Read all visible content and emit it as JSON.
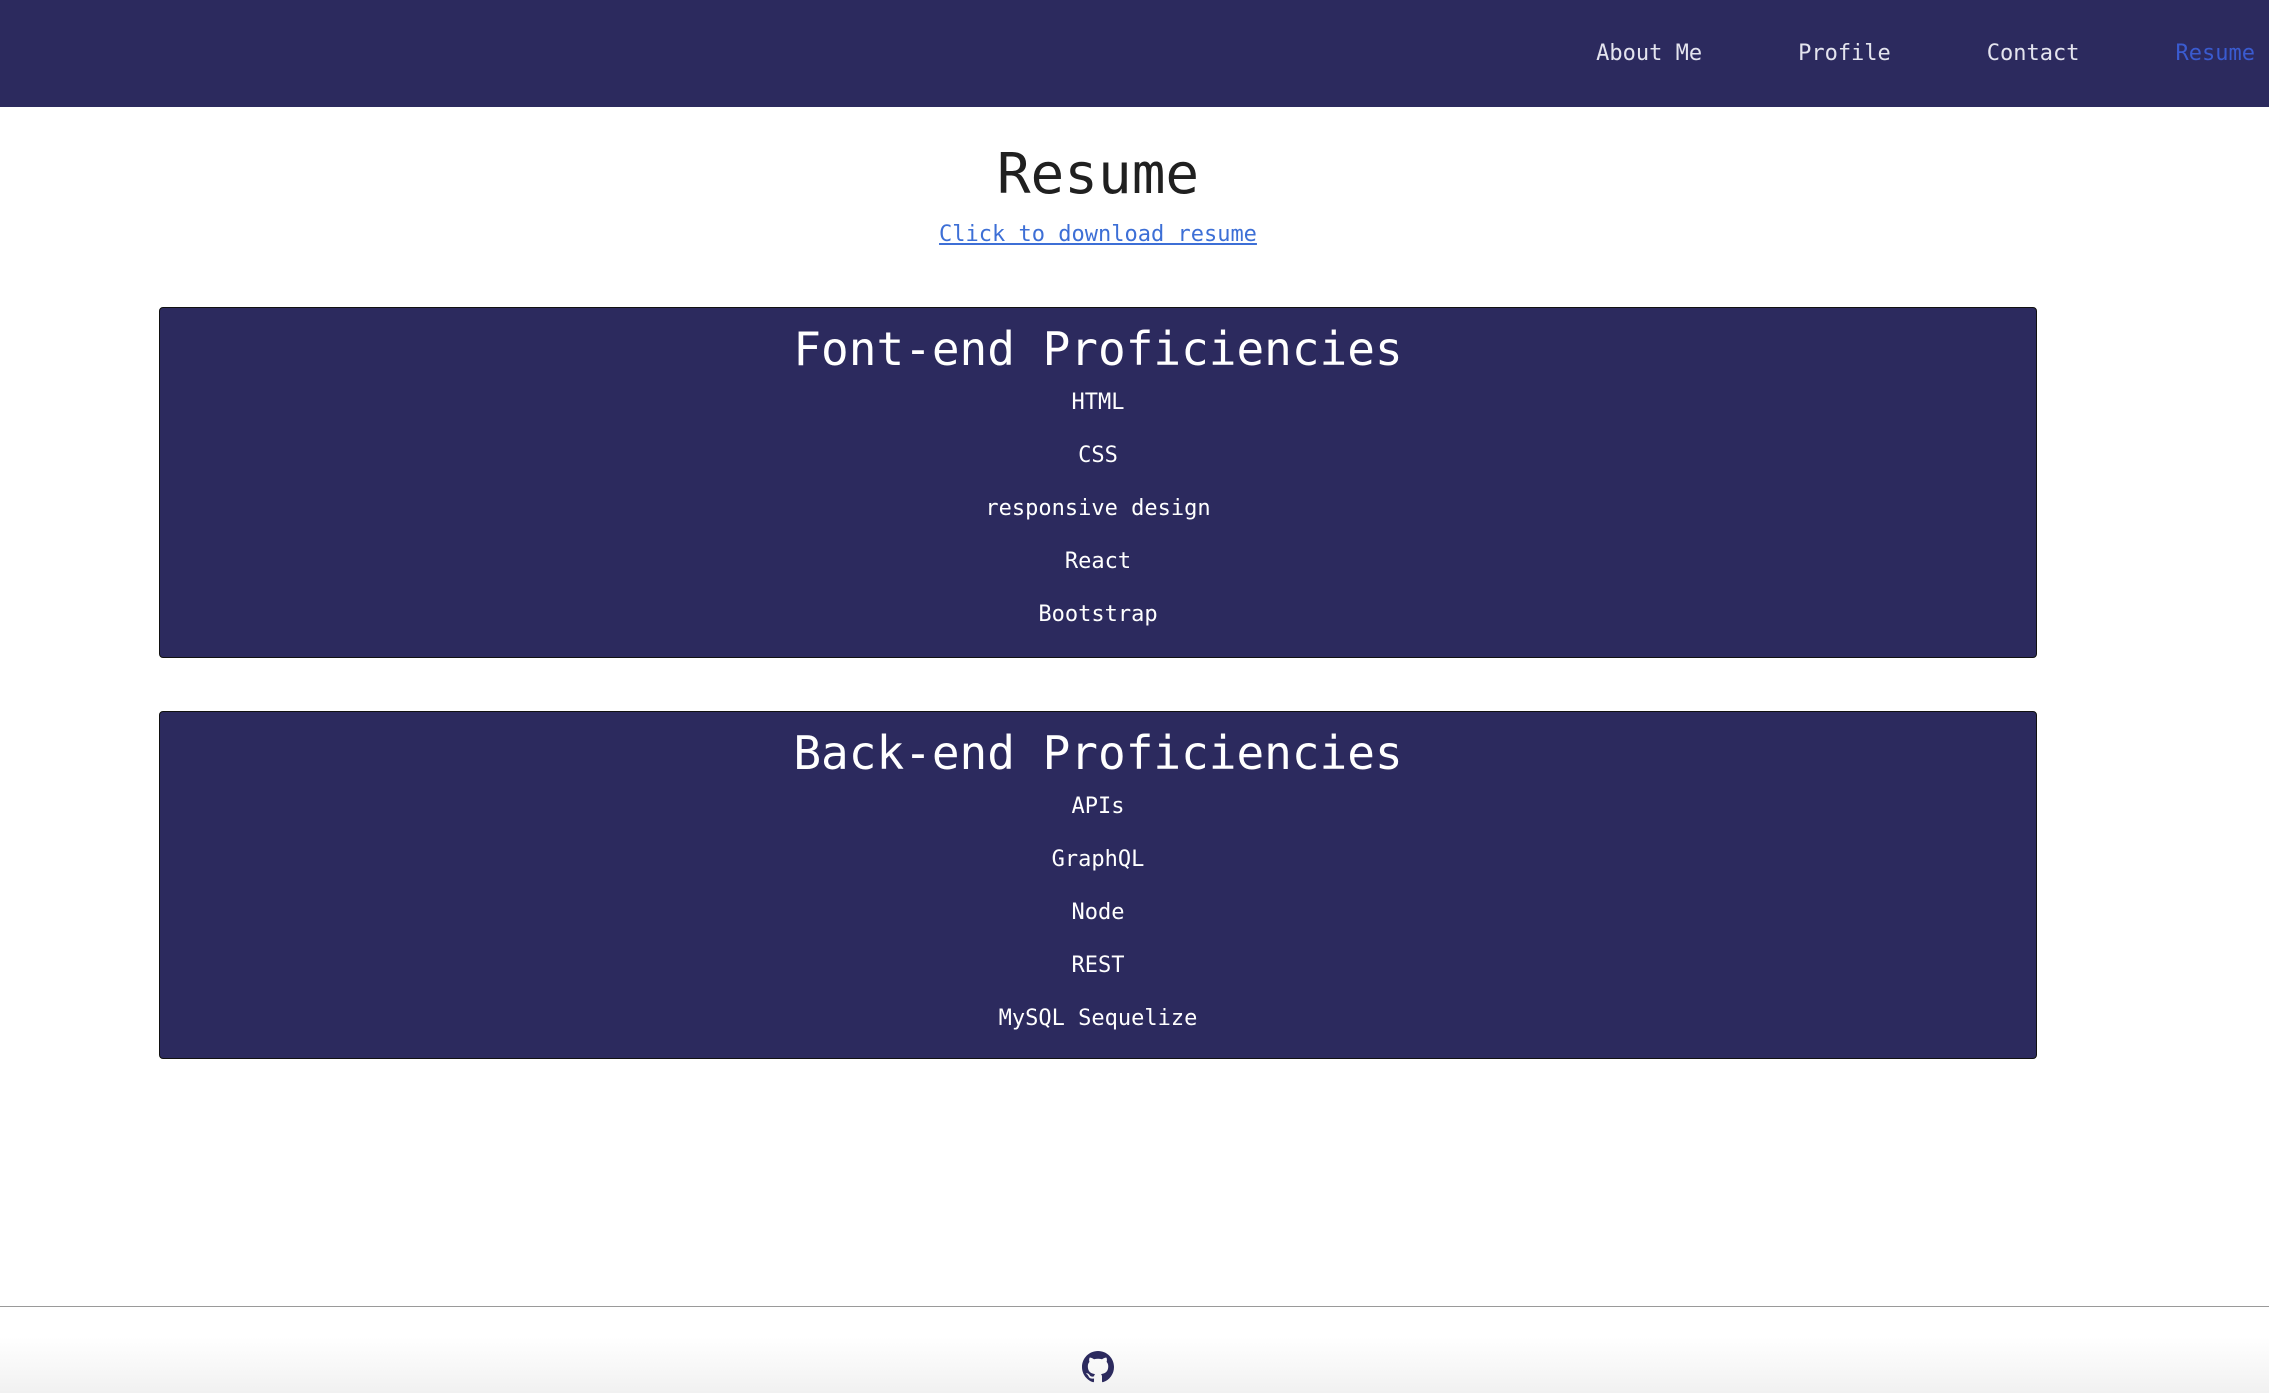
{
  "nav": {
    "items": [
      {
        "label": "About Me",
        "active": false
      },
      {
        "label": "Profile",
        "active": false
      },
      {
        "label": "Contact",
        "active": false
      },
      {
        "label": "Resume",
        "active": true
      }
    ]
  },
  "main": {
    "title": "Resume",
    "download_link": "Click to download resume"
  },
  "frontend": {
    "title": "Font-end Proficiencies",
    "skills": [
      "HTML",
      "CSS",
      "responsive design",
      "React",
      "Bootstrap"
    ]
  },
  "backend": {
    "title": "Back-end Proficiencies",
    "skills": [
      "APIs",
      "GraphQL",
      "Node",
      "REST",
      "MySQL Sequelize"
    ]
  },
  "footer": {
    "icon": "github-icon"
  },
  "colors": {
    "navbar_bg": "#2c2a5e",
    "card_bg": "#2c2a5e",
    "active_nav": "#3a5bd0",
    "link": "#3d6fd6"
  }
}
